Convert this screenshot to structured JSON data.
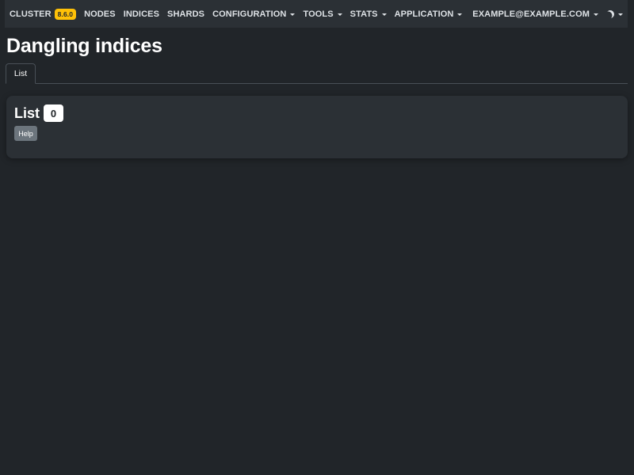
{
  "navbar": {
    "cluster_label": "CLUSTER",
    "cluster_version": "8.6.0",
    "nodes_label": "NODES",
    "indices_label": "INDICES",
    "shards_label": "SHARDS",
    "configuration_label": "CONFIGURATION",
    "tools_label": "TOOLS",
    "stats_label": "STATS",
    "application_label": "APPLICATION",
    "user_label": "EXAMPLE@EXAMPLE.COM",
    "theme_icon": "moon-icon"
  },
  "page": {
    "title": "Dangling indices"
  },
  "tabs": [
    {
      "label": "List",
      "active": true
    }
  ],
  "card": {
    "title": "List",
    "count": "0",
    "help_label": "Help"
  },
  "colors": {
    "background": "#212529",
    "navbar": "#2b3035",
    "version_badge": "#ffc107",
    "help_button": "#6c757d"
  }
}
